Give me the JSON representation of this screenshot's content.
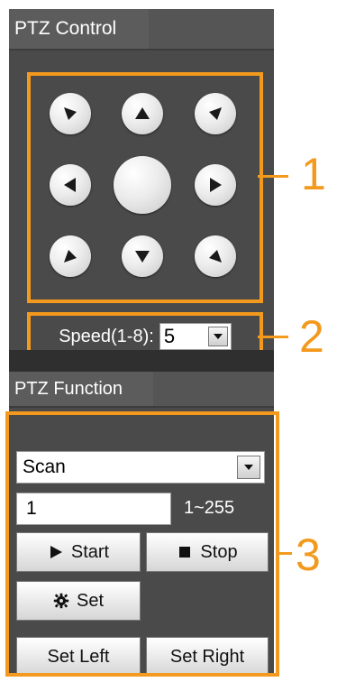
{
  "ptz_control": {
    "tab_label": "PTZ Control",
    "speed": {
      "label": "Speed(1-8):",
      "value": "5"
    }
  },
  "ptz_function": {
    "tab_label": "PTZ Function",
    "mode": {
      "value": "Scan"
    },
    "number": {
      "value": "1",
      "range": "1~255"
    },
    "buttons": {
      "start": "Start",
      "stop": "Stop",
      "set": "Set",
      "set_left": "Set Left",
      "set_right": "Set Right"
    }
  },
  "callouts": [
    "1",
    "2",
    "3"
  ],
  "colors": {
    "accent": "#f39a1e",
    "panel": "#4a4a4a",
    "tab": "#5c5c5c"
  },
  "icons": {
    "directions": [
      "up-left-arrow-icon",
      "up-arrow-icon",
      "up-right-arrow-icon",
      "left-arrow-icon",
      "center-button",
      "right-arrow-icon",
      "down-left-arrow-icon",
      "down-arrow-icon",
      "down-right-arrow-icon"
    ],
    "start": "play-icon",
    "stop": "stop-square-icon",
    "set": "gear-icon"
  }
}
